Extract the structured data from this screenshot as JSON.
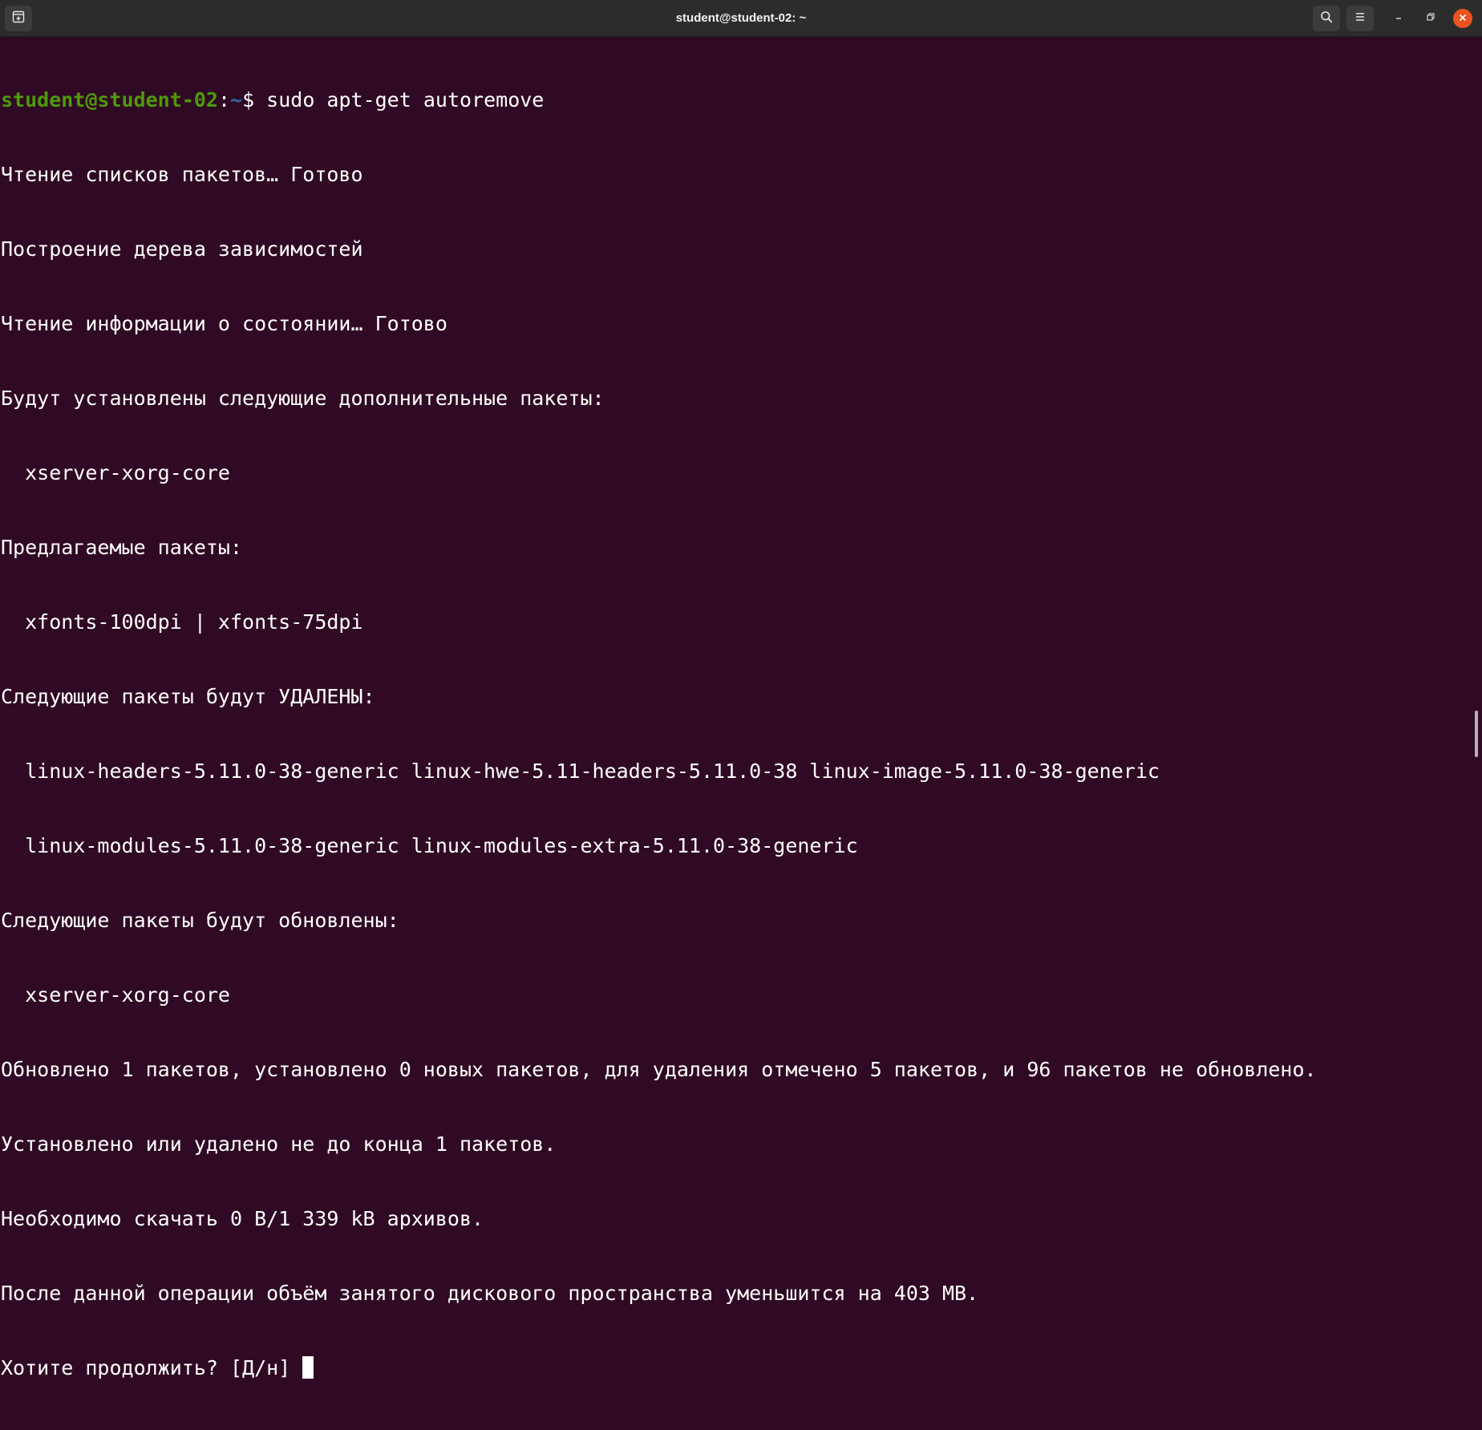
{
  "window": {
    "title": "student@student-02: ~"
  },
  "titlebar": {
    "new_tab_icon": "new-tab-icon",
    "search_icon": "search-icon",
    "menu_icon": "hamburger-menu-icon",
    "minimize_icon": "minimize-icon",
    "maximize_icon": "maximize-icon",
    "close_icon": "close-icon",
    "close_color": "#e95420"
  },
  "colors": {
    "background": "#300a24",
    "text": "#ffffff",
    "prompt_user": "#4e9a06",
    "prompt_path": "#3465a4"
  },
  "terminal": {
    "prompt": {
      "user_host": "student@student-02",
      "separator": ":",
      "path": "~",
      "symbol": "$ ",
      "command": "sudo apt-get autoremove"
    },
    "output": [
      "Чтение списков пакетов… Готово",
      "Построение дерева зависимостей",
      "Чтение информации о состоянии… Готово",
      "Будут установлены следующие дополнительные пакеты:",
      "  xserver-xorg-core",
      "Предлагаемые пакеты:",
      "  xfonts-100dpi | xfonts-75dpi",
      "Следующие пакеты будут УДАЛЕНЫ:",
      "  linux-headers-5.11.0-38-generic linux-hwe-5.11-headers-5.11.0-38 linux-image-5.11.0-38-generic",
      "  linux-modules-5.11.0-38-generic linux-modules-extra-5.11.0-38-generic",
      "Следующие пакеты будут обновлены:",
      "  xserver-xorg-core",
      "Обновлено 1 пакетов, установлено 0 новых пакетов, для удаления отмечено 5 пакетов, и 96 пакетов не обновлено.",
      "Установлено или удалено не до конца 1 пакетов.",
      "Необходимо скачать 0 B/1 339 kB архивов.",
      "После данной операции объём занятого дискового пространства уменьшится на 403 MB."
    ],
    "question": "Хотите продолжить? [Д/н] "
  }
}
